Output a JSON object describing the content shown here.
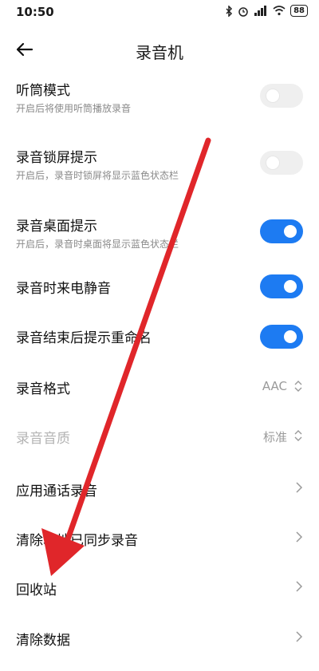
{
  "status_bar": {
    "time": "10:50",
    "battery": "88"
  },
  "header": {
    "title": "录音机"
  },
  "settings": {
    "earpiece_mode": {
      "title": "听筒模式",
      "subtitle": "开启后将使用听筒播放录音",
      "state": "off"
    },
    "lockscreen_tip": {
      "title": "录音锁屏提示",
      "subtitle": "开启后，录音时锁屏将显示蓝色状态栏",
      "state": "off"
    },
    "desktop_tip": {
      "title": "录音桌面提示",
      "subtitle": "开启后，录音时桌面将显示蓝色状态栏",
      "state": "on"
    },
    "mute_on_call": {
      "title": "录音时来电静音",
      "state": "on"
    },
    "rename_prompt": {
      "title": "录音结束后提示重命名",
      "state": "on"
    },
    "format": {
      "title": "录音格式",
      "value": "AAC"
    },
    "quality": {
      "title": "录音音质",
      "value": "标准"
    },
    "app_call_recording": {
      "title": "应用通话录音"
    },
    "clear_synced": {
      "title": "清除本地已同步录音"
    },
    "recycle_bin": {
      "title": "回收站"
    },
    "clear_data": {
      "title": "清除数据"
    }
  },
  "colors": {
    "accent": "#1d7bf2",
    "annotation_arrow": "#e0262a"
  }
}
